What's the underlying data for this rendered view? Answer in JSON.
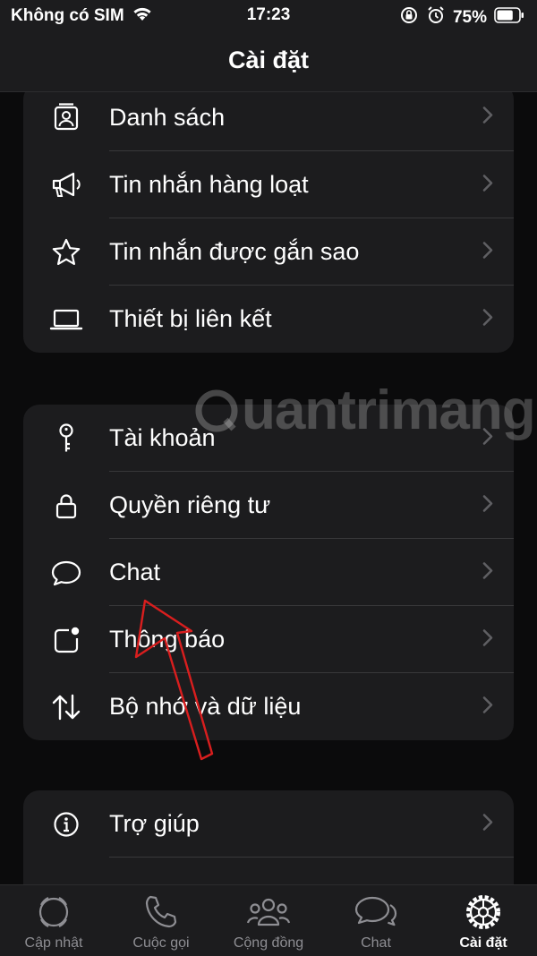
{
  "status_bar": {
    "carrier": "Không có SIM",
    "time": "17:23",
    "battery": "75%",
    "battery_level": 0.75
  },
  "nav": {
    "title": "Cài đặt"
  },
  "group1": {
    "items": [
      {
        "label": "Danh sách",
        "icon": "contact-card-icon"
      },
      {
        "label": "Tin nhắn hàng loạt",
        "icon": "megaphone-icon"
      },
      {
        "label": "Tin nhắn được gắn sao",
        "icon": "star-icon"
      },
      {
        "label": "Thiết bị liên kết",
        "icon": "laptop-icon"
      }
    ]
  },
  "group2": {
    "items": [
      {
        "label": "Tài khoản",
        "icon": "key-icon"
      },
      {
        "label": "Quyền riêng tư",
        "icon": "lock-icon"
      },
      {
        "label": "Chat",
        "icon": "chat-bubble-icon"
      },
      {
        "label": "Thông báo",
        "icon": "notification-icon"
      },
      {
        "label": "Bộ nhớ và dữ liệu",
        "icon": "up-down-arrows-icon"
      }
    ]
  },
  "group3": {
    "items": [
      {
        "label": "Trợ giúp",
        "icon": "info-icon"
      }
    ]
  },
  "watermark": "uantrimang",
  "tabs": [
    {
      "label": "Cập nhật",
      "icon": "updates-icon",
      "active": false
    },
    {
      "label": "Cuộc gọi",
      "icon": "phone-icon",
      "active": false
    },
    {
      "label": "Cộng đồng",
      "icon": "community-icon",
      "active": false
    },
    {
      "label": "Chat",
      "icon": "chats-icon",
      "active": false
    },
    {
      "label": "Cài đặt",
      "icon": "settings-gear-icon",
      "active": true
    }
  ],
  "colors": {
    "accent_arrow": "#d91e1e",
    "background": "#000000",
    "card": "#1c1c1e"
  }
}
